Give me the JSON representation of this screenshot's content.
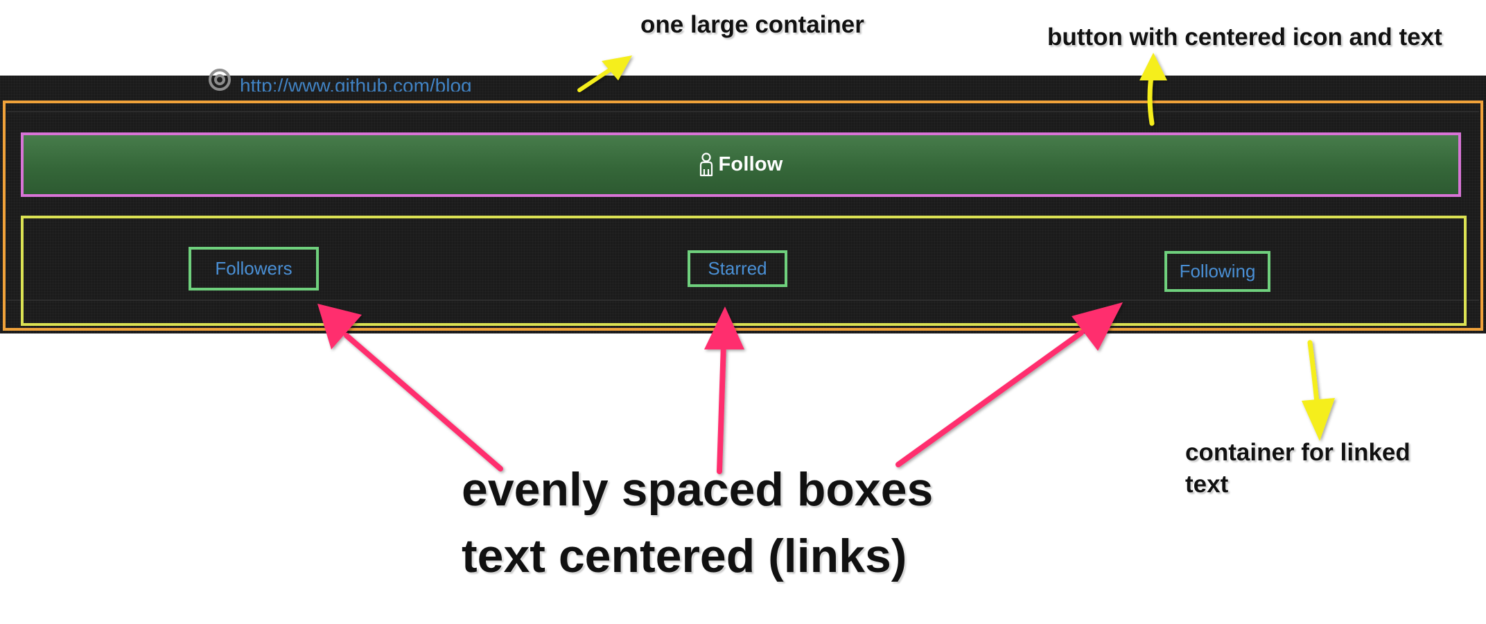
{
  "profile": {
    "blog_link": "http://www.github.com/blog",
    "link_icon": "link-icon"
  },
  "follow_button": {
    "label": "Follow",
    "icon": "person-icon",
    "color": "#3a6f3e"
  },
  "stats": [
    {
      "label": "Followers"
    },
    {
      "label": "Starred"
    },
    {
      "label": "Following"
    }
  ],
  "annotations": {
    "container": "one large container",
    "button": "button with centered icon and text",
    "linked_container_line1": "container for linked",
    "linked_container_line2": "text",
    "evenly_line1": "evenly spaced boxes",
    "evenly_line2": "text centered (links)"
  },
  "colors": {
    "outer_container": "#f0a23a",
    "button_outline": "#d874d6",
    "links_container": "#dbe253",
    "link_box": "#6fd07d",
    "yellow_arrow": "#f5ee1a",
    "pink_arrow": "#ff2f6e",
    "link_text": "#4a90d6"
  }
}
